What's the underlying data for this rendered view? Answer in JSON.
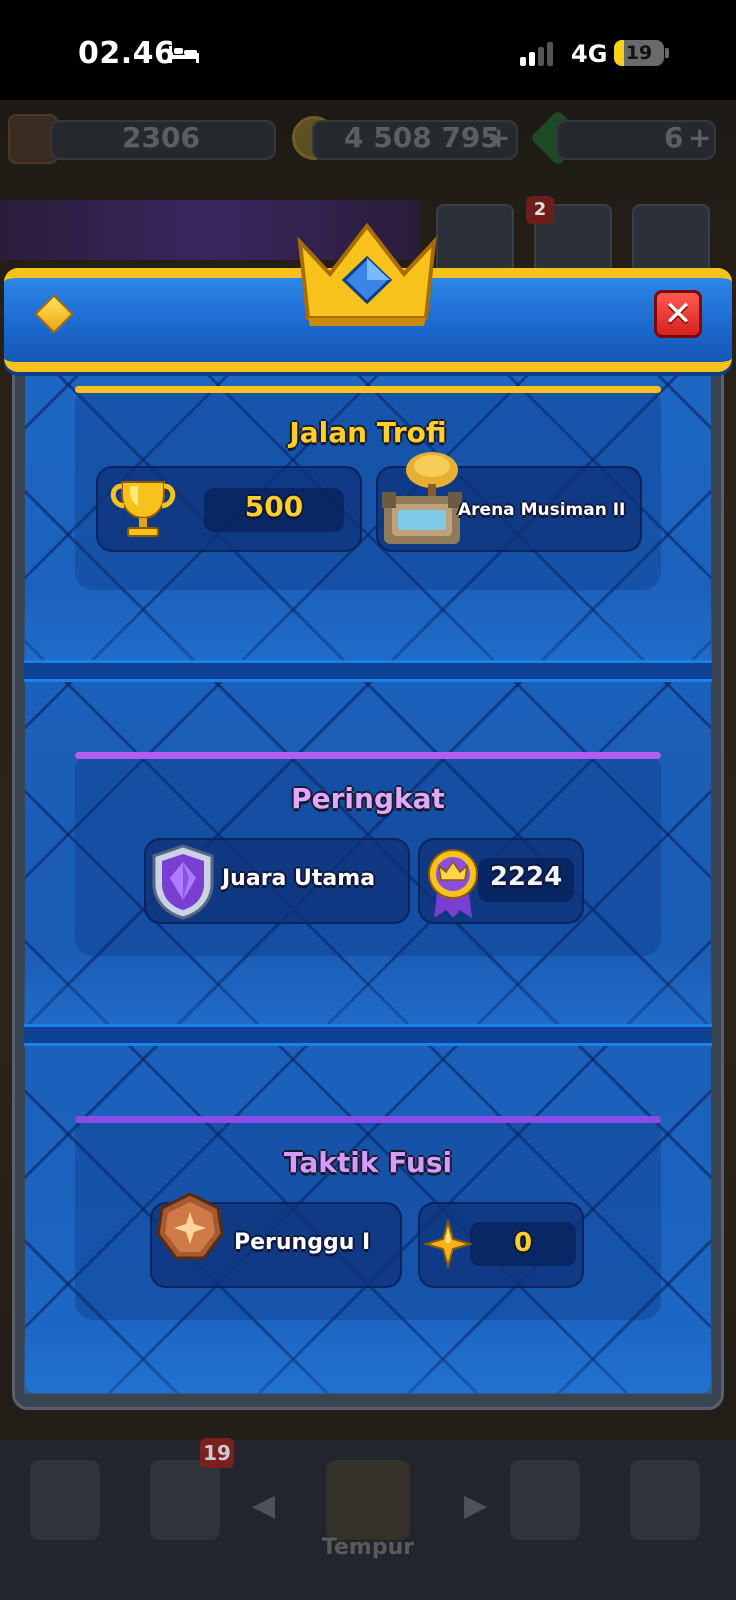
{
  "status_bar": {
    "time": "02.46",
    "network": "4G",
    "battery": "19"
  },
  "background": {
    "trophies": "2306",
    "gold": "4 508 795",
    "gold_plus": "+",
    "gems": "6",
    "gems_plus": "+",
    "news_badge": "2",
    "cards_badge": "19",
    "nav_label": "Tempur"
  },
  "modal": {
    "close_label": "✕",
    "sections": {
      "trophy_road": {
        "title": "Jalan Trofi",
        "trophies": "500",
        "arena": "Arena Musiman II",
        "accent": "#f7c21c"
      },
      "ranked": {
        "title": "Peringkat",
        "league": "Juara Utama",
        "rating": "2224",
        "accent": "#b35cf0"
      },
      "fusion": {
        "title": "Taktik Fusi",
        "league": "Perunggu I",
        "points": "0",
        "accent": "#8a4be8"
      }
    }
  }
}
